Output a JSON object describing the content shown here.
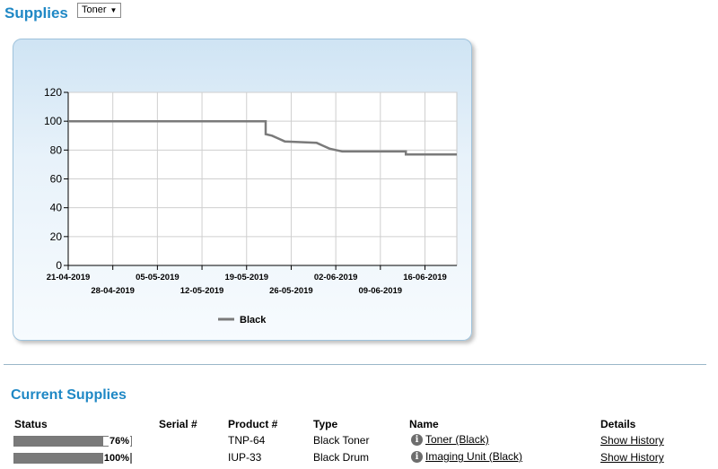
{
  "header": {
    "title": "Supplies",
    "filter_select": {
      "selected": "Toner"
    }
  },
  "chart_data": {
    "type": "line",
    "ylim": [
      0,
      120
    ],
    "yticks": [
      0,
      20,
      40,
      60,
      80,
      100,
      120
    ],
    "xlim": [
      "21-04-2019",
      "21-06-2019"
    ],
    "xticks_row1": [
      "21-04-2019",
      "05-05-2019",
      "19-05-2019",
      "02-06-2019",
      "16-06-2019"
    ],
    "xticks_row2": [
      "28-04-2019",
      "12-05-2019",
      "26-05-2019",
      "09-06-2019"
    ],
    "grid": true,
    "legend": "bottom",
    "series": [
      {
        "name": "Black",
        "color": "#7a7a7a",
        "points": [
          [
            "21-04-2019",
            100
          ],
          [
            "22-05-2019",
            100
          ],
          [
            "22-05-2019",
            91
          ],
          [
            "23-05-2019",
            90
          ],
          [
            "24-05-2019",
            88
          ],
          [
            "25-05-2019",
            86
          ],
          [
            "30-05-2019",
            85
          ],
          [
            "31-05-2019",
            83
          ],
          [
            "01-06-2019",
            81
          ],
          [
            "02-06-2019",
            80
          ],
          [
            "03-06-2019",
            79
          ],
          [
            "13-06-2019",
            79
          ],
          [
            "13-06-2019",
            77
          ],
          [
            "21-06-2019",
            77
          ]
        ]
      }
    ]
  },
  "current_supplies": {
    "title": "Current Supplies",
    "columns": {
      "status": "Status",
      "serial": "Serial #",
      "product": "Product #",
      "type": "Type",
      "name": "Name",
      "details": "Details"
    },
    "rows": [
      {
        "status_pct": 76,
        "status_label": "76%",
        "serial": "",
        "product": "TNP-64",
        "type": "Black Toner",
        "name": "Toner (Black)",
        "details": "Show History"
      },
      {
        "status_pct": 100,
        "status_label": "100%",
        "serial": "",
        "product": "IUP-33",
        "type": "Black Drum",
        "name": "Imaging Unit (Black)",
        "details": "Show History"
      }
    ]
  }
}
